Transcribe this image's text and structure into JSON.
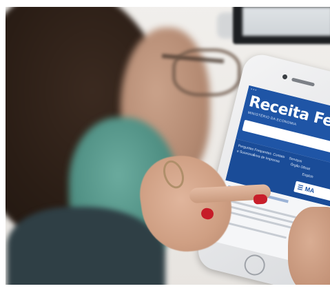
{
  "phone_site": {
    "title": "Receita Fede",
    "subtitle": "MINISTÉRIO DA ECONOMIA",
    "nav_links": [
      "Perguntas Frequentes",
      "Contato",
      "Serviços",
      "e Sucessos",
      "Área de Imprensa",
      "Órgão Oficial",
      "English"
    ],
    "menu_label": "MA",
    "menu_icon": "hamburger-icon"
  },
  "colors": {
    "site_blue": "#1f55a6",
    "nav_blue": "#1a4c98",
    "nail_red": "#c81e2a",
    "mask_green": "#4f8f83"
  }
}
